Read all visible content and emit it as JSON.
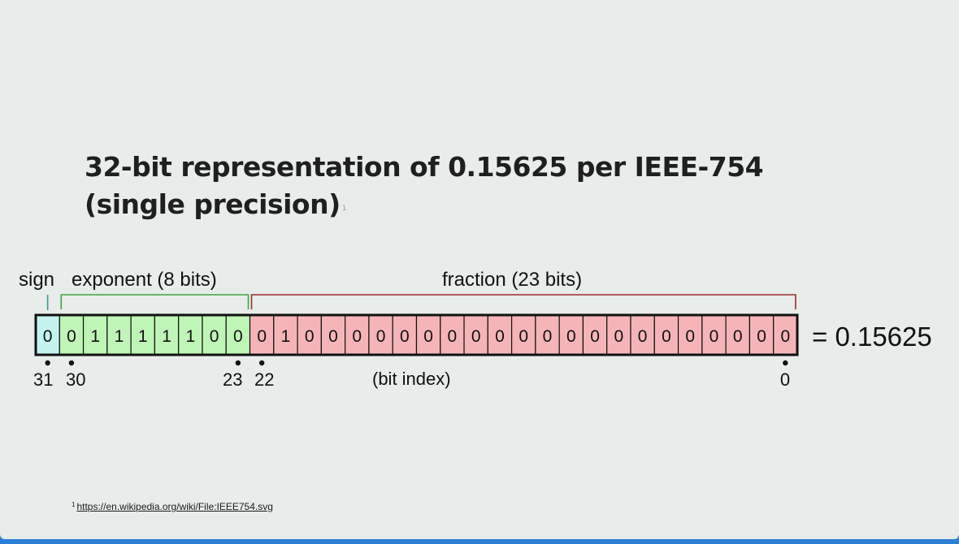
{
  "title": {
    "line1": "32-bit representation of 0.15625 per IEEE-754",
    "line2": "(single precision)",
    "footnote_ref": "1"
  },
  "diagram": {
    "labels": {
      "sign": "sign",
      "exponent": "exponent (8 bits)",
      "fraction": "fraction (23 bits)",
      "bit_index": "(bit index)"
    },
    "bits": [
      "0",
      "0",
      "1",
      "1",
      "1",
      "1",
      "1",
      "0",
      "0",
      "0",
      "1",
      "0",
      "0",
      "0",
      "0",
      "0",
      "0",
      "0",
      "0",
      "0",
      "0",
      "0",
      "0",
      "0",
      "0",
      "0",
      "0",
      "0",
      "0",
      "0",
      "0",
      "0"
    ],
    "segments": {
      "sign": 1,
      "exponent": 8,
      "fraction": 23
    },
    "index_labels": [
      "31",
      "30",
      "23",
      "22",
      "0"
    ],
    "equals_text": "= 0.15625",
    "colors": {
      "sign_fill": "#c4f3f0",
      "exponent_fill": "#bff5b6",
      "fraction_fill": "#f5b5b8",
      "exponent_bracket": "#3aa83a",
      "fraction_bracket": "#9c2f2f",
      "sign_bracket": "#3a9a8f"
    }
  },
  "footnote": {
    "mark": "1",
    "link_text": "https://en.wikipedia.org/wiki/File:IEEE754.svg"
  }
}
